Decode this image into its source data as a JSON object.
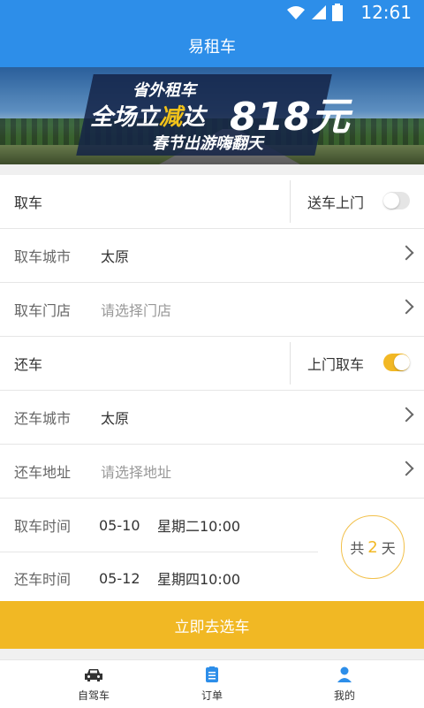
{
  "status_bar": {
    "time": "12:61"
  },
  "header": {
    "title": "易租车"
  },
  "banner": {
    "line1": "省外租车",
    "line2_prefix": "全场立",
    "line2_highlight": "减",
    "line2_suffix": "达",
    "amount": "818元",
    "line3": "春节出游嗨翻天"
  },
  "pickup": {
    "section_label": "取车",
    "delivery_label": "送车上门",
    "delivery_on": false,
    "city_label": "取车城市",
    "city_value": "太原",
    "store_label": "取车门店",
    "store_placeholder": "请选择门店"
  },
  "return": {
    "section_label": "还车",
    "pickup_service_label": "上门取车",
    "pickup_service_on": true,
    "city_label": "还车城市",
    "city_value": "太原",
    "address_label": "还车地址",
    "address_placeholder": "请选择地址"
  },
  "times": {
    "pickup_label": "取车时间",
    "pickup_date": "05-10",
    "pickup_weekday_time": "星期二10:00",
    "return_label": "还车时间",
    "return_date": "05-12",
    "return_weekday_time": "星期四10:00",
    "duration_prefix": "共",
    "duration_days": "2",
    "duration_suffix": "天"
  },
  "cta": {
    "label": "立即去选车"
  },
  "tabs": [
    {
      "label": "自驾车",
      "icon": "car-icon"
    },
    {
      "label": "订单",
      "icon": "order-icon"
    },
    {
      "label": "我的",
      "icon": "user-icon"
    }
  ],
  "colors": {
    "primary": "#2d8ee9",
    "accent": "#f1b824"
  }
}
